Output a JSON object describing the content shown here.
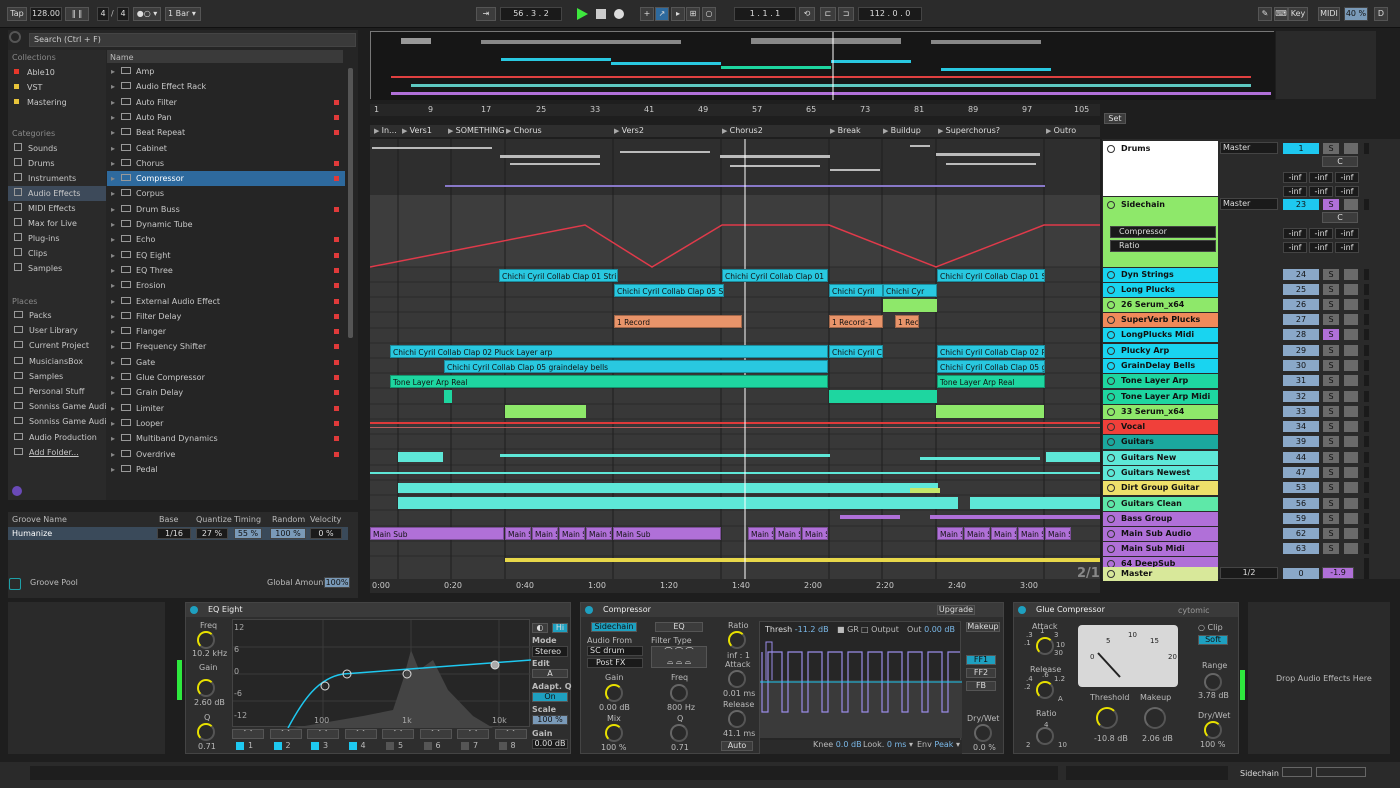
{
  "transport": {
    "tap": "Tap",
    "bpm": "128.00",
    "sig_num": "4",
    "sig_den": "4",
    "quantize": "1 Bar",
    "position": "56 . 3 . 2",
    "loop_start": "1 . 1 . 1",
    "loop_length": "112 . 0 . 0",
    "key": "Key",
    "midi": "MIDI",
    "cpu": "40 %",
    "disk": "D"
  },
  "browser": {
    "search": "Search (Ctrl + F)",
    "collections_header": "Collections",
    "collections": [
      {
        "label": "Able10",
        "color": "#e8372a"
      },
      {
        "label": "VST",
        "color": "#e8c43a"
      },
      {
        "label": "Mastering",
        "color": "#e8c43a"
      }
    ],
    "categories_header": "Categories",
    "categories": [
      "Sounds",
      "Drums",
      "Instruments",
      "Audio Effects",
      "MIDI Effects",
      "Max for Live",
      "Plug-ins",
      "Clips",
      "Samples"
    ],
    "places_header": "Places",
    "places": [
      "Packs",
      "User Library",
      "Current Project",
      "MusiciansBox",
      "Samples",
      "Personal Stuff",
      "Sonniss Game Audio",
      "Sonniss Game Audio",
      "Audio Production",
      "Add Folder..."
    ],
    "name_header": "Name",
    "items": [
      "Amp",
      "Audio Effect Rack",
      "Auto Filter",
      "Auto Pan",
      "Beat Repeat",
      "Cabinet",
      "Chorus",
      "Compressor",
      "Corpus",
      "Drum Buss",
      "Dynamic Tube",
      "Echo",
      "EQ Eight",
      "EQ Three",
      "Erosion",
      "External Audio Effect",
      "Filter Delay",
      "Flanger",
      "Frequency Shifter",
      "Gate",
      "Glue Compressor",
      "Grain Delay",
      "Limiter",
      "Looper",
      "Multiband Dynamics",
      "Overdrive",
      "Pedal"
    ]
  },
  "groove": {
    "h_name": "Groove Name",
    "h_base": "Base",
    "h_quantize": "Quantize",
    "h_timing": "Timing",
    "h_random": "Random",
    "h_velocity": "Velocity",
    "name": "Humanize",
    "base": "1/16",
    "quantize": "27 %",
    "timing": "55 %",
    "random": "100 %",
    "velocity": "0 %",
    "pool": "Groove Pool",
    "global_label": "Global Amount",
    "global": "100%"
  },
  "ruler": [
    "1",
    "9",
    "17",
    "25",
    "33",
    "41",
    "49",
    "57",
    "65",
    "73",
    "81",
    "89",
    "97",
    "105"
  ],
  "set_label": "Set",
  "locators": [
    "In...",
    "Vers1",
    "SOMETHING",
    "Chorus",
    "Vers2",
    "Chorus2",
    "Break",
    "Buildup",
    "Superchorus?",
    "Outro"
  ],
  "time_ruler": [
    "0:00",
    "0:20",
    "0:40",
    "1:00",
    "1:20",
    "1:40",
    "2:00",
    "2:20",
    "2:40",
    "3:00"
  ],
  "page_counter": "2/1",
  "clips": [
    "Chichi Cyril Collab Clap 01 String",
    "Chichi Cyril Collab Clap 01 Str",
    "Chichi Cyril Collab Clap 01 Str",
    "Chichi Cyril Collab Clap 05 Sup",
    "Chichi Cyril",
    "Chichi Cyr",
    "1 Record",
    "1 Record-1",
    "1 Rec",
    "Chichi Cyril Collab Clap 02 Pluck Layer arp",
    "Chichi Cyril Co",
    "Chichi Cyril Collab Clap 02 Plu",
    "Chichi Cyril Collab Clap 05 graindelay bells",
    "Chichi Cyril Collab Clap 05 gr",
    "Tone Layer Arp Real",
    "Tone Layer Arp Real",
    "Main Sub",
    "Main S",
    "Main S",
    "Main S",
    "Main S",
    "Main Sub",
    "Main S",
    "Main S",
    "Main S",
    "Main S",
    "Main S",
    "Main S",
    "Main S",
    "Main S"
  ],
  "tracks": [
    {
      "name": "Drums",
      "color": "#ffffff",
      "num": "1"
    },
    {
      "name": "Sidechain",
      "color": "#8ee86a",
      "num": "23"
    },
    {
      "name": "Dyn Strings",
      "color": "#19d4f0",
      "num": "24"
    },
    {
      "name": "Long Plucks",
      "color": "#19d4f0",
      "num": "25"
    },
    {
      "name": "26 Serum_x64",
      "color": "#8ee86a",
      "num": "26"
    },
    {
      "name": "SuperVerb Plucks",
      "color": "#f08a5a",
      "num": "27"
    },
    {
      "name": "LongPlucks Midi",
      "color": "#19d4f0",
      "num": "28"
    },
    {
      "name": "Plucky Arp",
      "color": "#19d4f0",
      "num": "29"
    },
    {
      "name": "GrainDelay Bells",
      "color": "#19d4f0",
      "num": "30"
    },
    {
      "name": "Tone Layer Arp",
      "color": "#1ed6a0",
      "num": "31"
    },
    {
      "name": "Tone Layer Arp Midi",
      "color": "#1ed6a0",
      "num": "32"
    },
    {
      "name": "33 Serum_x64",
      "color": "#8ee86a",
      "num": "33"
    },
    {
      "name": "Vocal",
      "color": "#f0403a",
      "num": "34"
    },
    {
      "name": "Guitars",
      "color": "#1ba89e",
      "num": "39"
    },
    {
      "name": "Guitars New",
      "color": "#5ee8d8",
      "num": "44"
    },
    {
      "name": "Guitars Newest",
      "color": "#5ee8d8",
      "num": "47"
    },
    {
      "name": "Dirt Group Guitar",
      "color": "#eee06a",
      "num": "53"
    },
    {
      "name": "Guitars Clean",
      "color": "#5ee8a8",
      "num": "56"
    },
    {
      "name": "Bass Group",
      "color": "#b070d8",
      "num": "59"
    },
    {
      "name": "Main Sub Audio",
      "color": "#b070d8",
      "num": "62"
    },
    {
      "name": "Main Sub Midi",
      "color": "#b070d8",
      "num": "63"
    },
    {
      "name": "64 DeepSub",
      "color": "#b070d8",
      "num": ""
    },
    {
      "name": "Master",
      "color": "#d8e89a",
      "num": "0"
    }
  ],
  "mixer": {
    "master1": "Master",
    "master2": "Master",
    "c": "C",
    "inf": "-inf",
    "s": "S",
    "comp": "Compressor",
    "ratio": "Ratio",
    "master_io": "1/2",
    "master_vol": "-1.9"
  },
  "eq": {
    "title": "EQ Eight",
    "freq_label": "Freq",
    "freq": "10.2 kHz",
    "gain_label": "Gain",
    "gain": "2.60 dB",
    "q_label": "Q",
    "q": "0.71",
    "db": [
      "12",
      "6",
      "0",
      "-6",
      "-12"
    ],
    "hz": [
      "100",
      "1k",
      "10k"
    ],
    "mode_label": "Mode",
    "mode": "Stereo",
    "edit": "Edit",
    "aq_label": "Adapt. Q",
    "aq": "On",
    "scale_label": "Scale",
    "scale": "100 %",
    "g_label": "Gain",
    "g": "0.00 dB",
    "bands": [
      "1",
      "2",
      "3",
      "4",
      "5",
      "6",
      "7",
      "8"
    ]
  },
  "comp": {
    "title": "Compressor",
    "sidechain": "Sidechain",
    "eq": "EQ",
    "af_label": "Audio From",
    "af": "SC drum",
    "pf": "Post FX",
    "ft_label": "Filter Type",
    "gain_label": "Gain",
    "gain": "0.00 dB",
    "mix_label": "Mix",
    "mix": "100 %",
    "freq_label": "Freq",
    "freq": "800 Hz",
    "q_label": "Q",
    "q": "0.71",
    "ratio_label": "Ratio",
    "ratio": "inf : 1",
    "attack_label": "Attack",
    "attack": "0.01 ms",
    "release_label": "Release",
    "release": "41.1 ms",
    "auto": "Auto",
    "thresh_label": "Thresh",
    "thresh": "-11.2 dB",
    "gr": "GR",
    "output": "Output",
    "out_label": "Out",
    "out": "0.00 dB",
    "makeup": "Makeup",
    "ff1": "FF1",
    "ff2": "FF2",
    "fb": "FB",
    "drywet_label": "Dry/Wet",
    "drywet": "0.0 %",
    "knee_label": "Knee",
    "knee": "0.0 dB",
    "look_label": "Look.",
    "look": "0 ms",
    "env_label": "Env",
    "env": "Peak",
    "upgrade": "Upgrade"
  },
  "glue": {
    "title": "Glue Compressor",
    "brand": "cytomic",
    "attack": "Attack",
    "attack_vals": [
      ".1",
      ".3",
      "1",
      "3",
      "10",
      "30"
    ],
    "release": "Release",
    "release_vals": [
      ".2",
      ".4",
      ".6",
      "1.2",
      "A"
    ],
    "ratio": "Ratio",
    "ratio_vals": [
      "2",
      "4",
      "10"
    ],
    "meter": [
      "0",
      "5",
      "10",
      "15",
      "20"
    ],
    "thresh_label": "Threshold",
    "thresh": "-10.8 dB",
    "makeup_label": "Makeup",
    "makeup": "2.06 dB",
    "clip": "Clip",
    "soft": "Soft",
    "range_label": "Range",
    "range": "3.78 dB",
    "dw_label": "Dry/Wet",
    "dw": "100 %"
  },
  "drop": "Drop Audio Effects Here",
  "status": {
    "sidechain": "Sidechain"
  }
}
